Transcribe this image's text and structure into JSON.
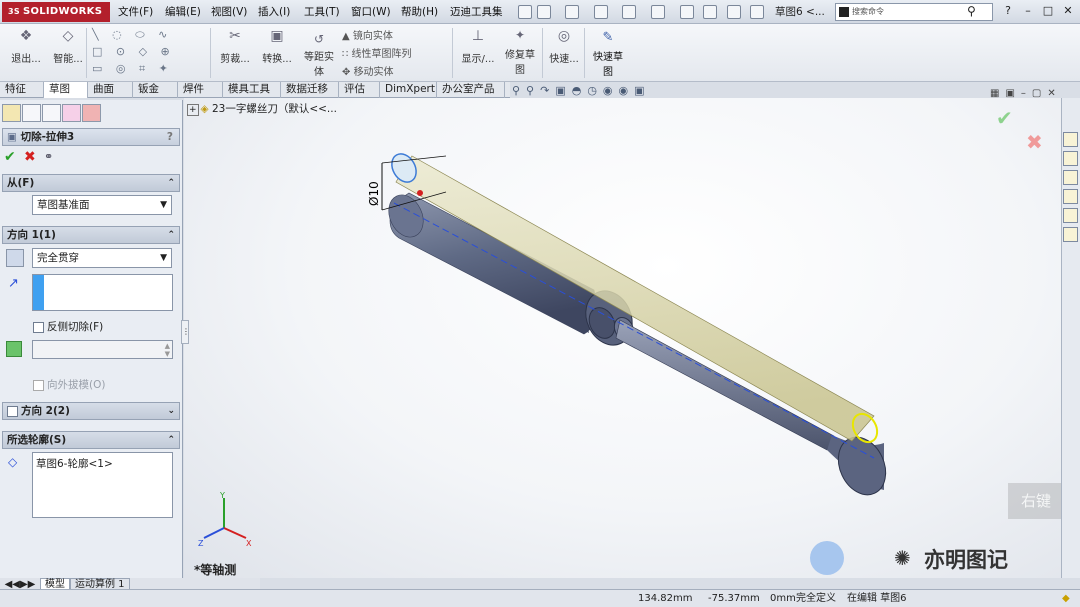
{
  "app": {
    "name": "SOLIDWORKS",
    "logo_prefix": "3S",
    "document_title": "草图6 <...",
    "search_placeholder": "搜索命令"
  },
  "menu": [
    "文件(F)",
    "编辑(E)",
    "视图(V)",
    "插入(I)",
    "工具(T)",
    "窗口(W)",
    "帮助(H)",
    "迈迪工具集"
  ],
  "ribbon": {
    "exit_sketch": "退出...",
    "smart_dim": "智能...",
    "trim": "剪裁...",
    "convert": "转换...",
    "offset_line1": "等距实",
    "offset_line2": "体",
    "mirror": "镜向实体",
    "linear_pattern": "线性草图阵列",
    "move": "移动实体",
    "display": "显示/...",
    "repair_line1": "修复草",
    "repair_line2": "图",
    "quick": "快速...",
    "quick_sketch_line1": "快速草",
    "quick_sketch_line2": "图"
  },
  "tabs": [
    "特征",
    "草图",
    "曲面",
    "钣金",
    "焊件",
    "模具工具",
    "数据迁移",
    "评估",
    "DimXpert",
    "办公室产品"
  ],
  "active_tab": "草图",
  "tree_header": "23一字螺丝刀（默认<<...",
  "property_manager": {
    "title": "切除-拉伸3",
    "help": "?",
    "from_section": "从(F)",
    "from_value": "草图基准面",
    "direction1_section": "方向 1(1)",
    "end_condition": "完全贯穿",
    "reverse_cut": "反侧切除(F)",
    "draft_outward": "向外拔模(O)",
    "direction2_section": "方向 2(2)",
    "selected_contours_section": "所选轮廓(S)",
    "selected_contour_item": "草图6-轮廓<1>"
  },
  "dimension_label": "Ø10",
  "view_label": "*等轴测",
  "triad": {
    "x": "X",
    "y": "Y",
    "z": "Z"
  },
  "bottom_tabs": [
    "模型",
    "运动算例 1"
  ],
  "status": {
    "x": "134.82mm",
    "y": "-75.37mm",
    "z": "0mm",
    "constraint": "完全定义",
    "editing": "在编辑 草图6"
  },
  "watermark": {
    "text": "亦明图记",
    "faded": "右键"
  },
  "colors": {
    "brand": "#b3202c",
    "confirm": "#2aa02a",
    "cancel": "#d42020",
    "model_body": "#5f6a85",
    "extrude_preview": "#d9d5a4",
    "edge_highlight": "#e8e600"
  }
}
